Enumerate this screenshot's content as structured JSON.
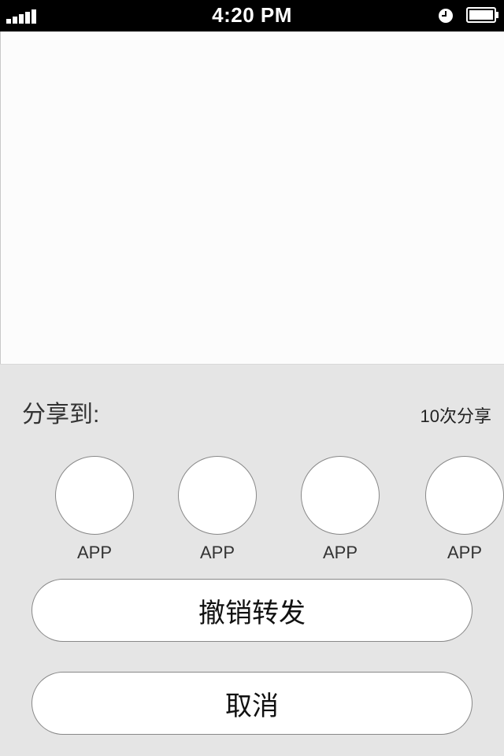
{
  "status_bar": {
    "time": "4:20 PM",
    "signal_bars": 5,
    "icons": [
      "signal-icon",
      "clock-icon",
      "battery-icon"
    ]
  },
  "share_sheet": {
    "title": "分享到:",
    "share_count": "10次分享",
    "apps": [
      {
        "label": "APP"
      },
      {
        "label": "APP"
      },
      {
        "label": "APP"
      },
      {
        "label": "APP"
      }
    ],
    "revoke_label": "撤销转发",
    "cancel_label": "取消"
  },
  "colors": {
    "status_bar_bg": "#000000",
    "content_bg": "#fcfcfc",
    "sheet_bg": "#e5e5e5",
    "button_bg": "#ffffff",
    "border": "#888888"
  }
}
